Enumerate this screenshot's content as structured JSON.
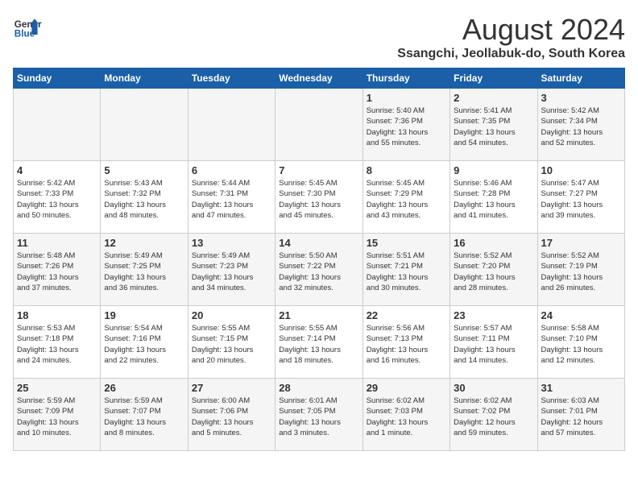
{
  "header": {
    "logo_line1": "General",
    "logo_line2": "Blue",
    "month_year": "August 2024",
    "location": "Ssangchi, Jeollabuk-do, South Korea"
  },
  "days_of_week": [
    "Sunday",
    "Monday",
    "Tuesday",
    "Wednesday",
    "Thursday",
    "Friday",
    "Saturday"
  ],
  "weeks": [
    [
      {
        "day": "",
        "info": ""
      },
      {
        "day": "",
        "info": ""
      },
      {
        "day": "",
        "info": ""
      },
      {
        "day": "",
        "info": ""
      },
      {
        "day": "1",
        "info": "Sunrise: 5:40 AM\nSunset: 7:36 PM\nDaylight: 13 hours\nand 55 minutes."
      },
      {
        "day": "2",
        "info": "Sunrise: 5:41 AM\nSunset: 7:35 PM\nDaylight: 13 hours\nand 54 minutes."
      },
      {
        "day": "3",
        "info": "Sunrise: 5:42 AM\nSunset: 7:34 PM\nDaylight: 13 hours\nand 52 minutes."
      }
    ],
    [
      {
        "day": "4",
        "info": "Sunrise: 5:42 AM\nSunset: 7:33 PM\nDaylight: 13 hours\nand 50 minutes."
      },
      {
        "day": "5",
        "info": "Sunrise: 5:43 AM\nSunset: 7:32 PM\nDaylight: 13 hours\nand 48 minutes."
      },
      {
        "day": "6",
        "info": "Sunrise: 5:44 AM\nSunset: 7:31 PM\nDaylight: 13 hours\nand 47 minutes."
      },
      {
        "day": "7",
        "info": "Sunrise: 5:45 AM\nSunset: 7:30 PM\nDaylight: 13 hours\nand 45 minutes."
      },
      {
        "day": "8",
        "info": "Sunrise: 5:45 AM\nSunset: 7:29 PM\nDaylight: 13 hours\nand 43 minutes."
      },
      {
        "day": "9",
        "info": "Sunrise: 5:46 AM\nSunset: 7:28 PM\nDaylight: 13 hours\nand 41 minutes."
      },
      {
        "day": "10",
        "info": "Sunrise: 5:47 AM\nSunset: 7:27 PM\nDaylight: 13 hours\nand 39 minutes."
      }
    ],
    [
      {
        "day": "11",
        "info": "Sunrise: 5:48 AM\nSunset: 7:26 PM\nDaylight: 13 hours\nand 37 minutes."
      },
      {
        "day": "12",
        "info": "Sunrise: 5:49 AM\nSunset: 7:25 PM\nDaylight: 13 hours\nand 36 minutes."
      },
      {
        "day": "13",
        "info": "Sunrise: 5:49 AM\nSunset: 7:23 PM\nDaylight: 13 hours\nand 34 minutes."
      },
      {
        "day": "14",
        "info": "Sunrise: 5:50 AM\nSunset: 7:22 PM\nDaylight: 13 hours\nand 32 minutes."
      },
      {
        "day": "15",
        "info": "Sunrise: 5:51 AM\nSunset: 7:21 PM\nDaylight: 13 hours\nand 30 minutes."
      },
      {
        "day": "16",
        "info": "Sunrise: 5:52 AM\nSunset: 7:20 PM\nDaylight: 13 hours\nand 28 minutes."
      },
      {
        "day": "17",
        "info": "Sunrise: 5:52 AM\nSunset: 7:19 PM\nDaylight: 13 hours\nand 26 minutes."
      }
    ],
    [
      {
        "day": "18",
        "info": "Sunrise: 5:53 AM\nSunset: 7:18 PM\nDaylight: 13 hours\nand 24 minutes."
      },
      {
        "day": "19",
        "info": "Sunrise: 5:54 AM\nSunset: 7:16 PM\nDaylight: 13 hours\nand 22 minutes."
      },
      {
        "day": "20",
        "info": "Sunrise: 5:55 AM\nSunset: 7:15 PM\nDaylight: 13 hours\nand 20 minutes."
      },
      {
        "day": "21",
        "info": "Sunrise: 5:55 AM\nSunset: 7:14 PM\nDaylight: 13 hours\nand 18 minutes."
      },
      {
        "day": "22",
        "info": "Sunrise: 5:56 AM\nSunset: 7:13 PM\nDaylight: 13 hours\nand 16 minutes."
      },
      {
        "day": "23",
        "info": "Sunrise: 5:57 AM\nSunset: 7:11 PM\nDaylight: 13 hours\nand 14 minutes."
      },
      {
        "day": "24",
        "info": "Sunrise: 5:58 AM\nSunset: 7:10 PM\nDaylight: 13 hours\nand 12 minutes."
      }
    ],
    [
      {
        "day": "25",
        "info": "Sunrise: 5:59 AM\nSunset: 7:09 PM\nDaylight: 13 hours\nand 10 minutes."
      },
      {
        "day": "26",
        "info": "Sunrise: 5:59 AM\nSunset: 7:07 PM\nDaylight: 13 hours\nand 8 minutes."
      },
      {
        "day": "27",
        "info": "Sunrise: 6:00 AM\nSunset: 7:06 PM\nDaylight: 13 hours\nand 5 minutes."
      },
      {
        "day": "28",
        "info": "Sunrise: 6:01 AM\nSunset: 7:05 PM\nDaylight: 13 hours\nand 3 minutes."
      },
      {
        "day": "29",
        "info": "Sunrise: 6:02 AM\nSunset: 7:03 PM\nDaylight: 13 hours\nand 1 minute."
      },
      {
        "day": "30",
        "info": "Sunrise: 6:02 AM\nSunset: 7:02 PM\nDaylight: 12 hours\nand 59 minutes."
      },
      {
        "day": "31",
        "info": "Sunrise: 6:03 AM\nSunset: 7:01 PM\nDaylight: 12 hours\nand 57 minutes."
      }
    ]
  ]
}
